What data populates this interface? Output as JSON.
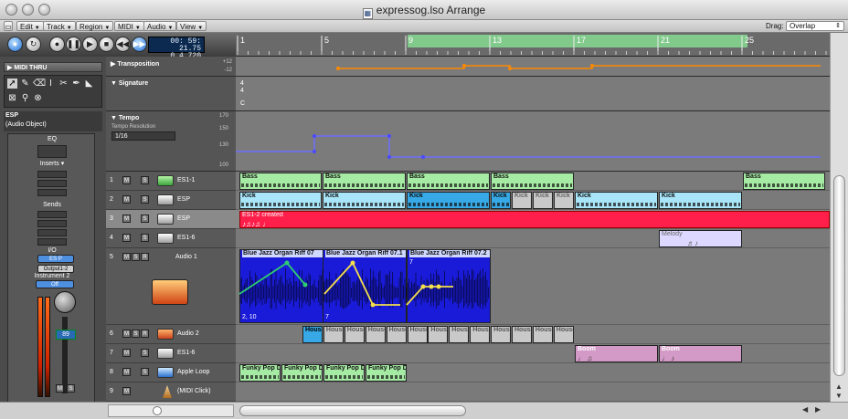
{
  "window": {
    "title": "expressog.lso Arrange"
  },
  "menubar": {
    "items": [
      "Edit",
      "Track",
      "Region",
      "MIDI",
      "Audio",
      "View"
    ],
    "drag_label": "Drag:",
    "drag_value": "Overlap"
  },
  "transport": {
    "lcd_line1": "00: 59: 21.75",
    "lcd_line2": "0  4   720"
  },
  "inspector": {
    "midi_thru": "MIDI THRU",
    "object_name": "ESP",
    "object_type": "(Audio Object)",
    "eq": "EQ",
    "inserts": "Inserts",
    "sends": "Sends",
    "io": "I/O",
    "input": "ES P",
    "output": "Output1-2",
    "instrument": "Instrument 2",
    "automation": "Off",
    "volume": "89",
    "volume_fraction": 0.7
  },
  "ruler": {
    "bars": [
      "1",
      "5",
      "9",
      "13",
      "17",
      "21",
      "25"
    ]
  },
  "global_tracks": {
    "transposition": {
      "label": "Transposition",
      "top": "+12",
      "bottom": "-12"
    },
    "signature": {
      "label": "Signature",
      "value_top": "4",
      "value_bottom": "4",
      "key": "C"
    },
    "tempo": {
      "label": "Tempo",
      "resolution_label": "Tempo Resolution",
      "resolution": "1/16",
      "scale": [
        "170",
        "150",
        "130",
        "100"
      ]
    }
  },
  "tracks": [
    {
      "num": "1",
      "name": "ES1-1",
      "icon": "synth-icon",
      "selected": false
    },
    {
      "num": "2",
      "name": "ESP",
      "icon": "keyboard-icon",
      "selected": false
    },
    {
      "num": "3",
      "name": "ESP",
      "icon": "keyboard-icon",
      "selected": true
    },
    {
      "num": "4",
      "name": "ES1-6",
      "icon": "keyboard-icon",
      "selected": false
    },
    {
      "num": "5",
      "name": "Audio 1",
      "icon": "audio-icon",
      "selected": false
    },
    {
      "num": "6",
      "name": "Audio 2",
      "icon": "audio-icon",
      "selected": false
    },
    {
      "num": "7",
      "name": "ES1-6",
      "icon": "keyboard-icon",
      "selected": false
    },
    {
      "num": "8",
      "name": "Apple Loop",
      "icon": "loop-icon",
      "selected": false
    },
    {
      "num": "9",
      "name": "(MIDI Click)",
      "icon": "metronome-icon",
      "selected": false
    }
  ],
  "regions": {
    "bass": [
      "Bass",
      "Bass",
      "Bass",
      "Bass",
      "Bass"
    ],
    "kick": [
      "Kick",
      "Kick",
      "Kick",
      "Kick",
      "Kick",
      "Kick",
      "Kick",
      "Kick",
      "Kick"
    ],
    "es1": "ES1-2 created",
    "melody": "Melody",
    "audio1": [
      "Blue Jazz Organ Riff 07",
      "Blue Jazz Organ Riff 07.1",
      "Blue Jazz Organ Riff 07.2"
    ],
    "audio1_labels": [
      "2, 10",
      "7",
      "7"
    ],
    "house": [
      "House",
      "House",
      "House",
      "House",
      "House",
      "House",
      "House",
      "House",
      "House",
      "House",
      "House",
      "House",
      "House"
    ],
    "boom": [
      "Boom",
      "Boom"
    ],
    "funky": [
      "Funky Pop D",
      "Funky Pop D",
      "Funky Pop D",
      "Funky Pop D"
    ]
  },
  "colors": {
    "region_green": "#a6eba4",
    "region_cyan": "#a8e5f8",
    "region_red": "#ff1f4a",
    "region_audio": "#1a1bd8",
    "region_pink": "#d49ac7",
    "cycle": "#82c98c"
  }
}
